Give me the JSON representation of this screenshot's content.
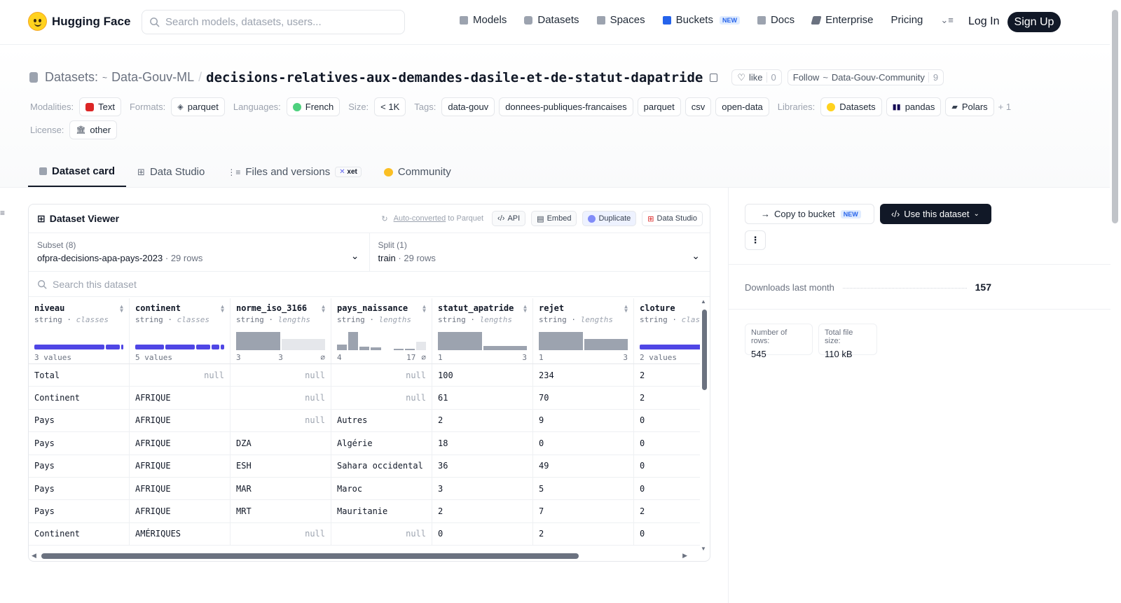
{
  "nav": {
    "brand": "Hugging Face",
    "search_placeholder": "Search models, datasets, users...",
    "links": [
      {
        "label": "Models",
        "icon": "models-icon",
        "color": "#9ca3af"
      },
      {
        "label": "Datasets",
        "icon": "datasets-icon",
        "color": "#9ca3af"
      },
      {
        "label": "Spaces",
        "icon": "spaces-icon",
        "color": "#9ca3af"
      },
      {
        "label": "Buckets",
        "icon": "buckets-icon",
        "color": "#2563eb"
      },
      {
        "label": "Docs",
        "icon": "docs-icon",
        "color": "#9ca3af"
      },
      {
        "label": "Enterprise",
        "icon": "enterprise-icon",
        "color": "#6b7280"
      },
      {
        "label": "Pricing",
        "icon": "",
        "color": ""
      }
    ],
    "buckets_badge": "NEW",
    "login": "Log In",
    "signup": "Sign Up"
  },
  "header": {
    "section": "Datasets:",
    "org": "Data-Gouv-ML",
    "repo": "decisions-relatives-aux-demandes-dasile-et-de-statut-dapatride",
    "like_label": "like",
    "like_count": "0",
    "follow_label": "Follow",
    "follow_org": "Data-Gouv-Community",
    "follow_count": "9",
    "modalities_label": "Modalities:",
    "modality": "Text",
    "formats_label": "Formats:",
    "format": "parquet",
    "languages_label": "Languages:",
    "language": "French",
    "size_label": "Size:",
    "size": "< 1K",
    "tags_label": "Tags:",
    "tags": [
      "data-gouv",
      "donnees-publiques-francaises",
      "parquet",
      "csv",
      "open-data"
    ],
    "libraries_label": "Libraries:",
    "libraries": [
      "Datasets",
      "pandas",
      "Polars"
    ],
    "libraries_more": "+ 1",
    "license_label": "License:",
    "license": "other"
  },
  "tabs": [
    {
      "label": "Dataset card",
      "icon": "cube-icon"
    },
    {
      "label": "Data Studio",
      "icon": "table-icon"
    },
    {
      "label": "Files and versions",
      "icon": "files-icon"
    },
    {
      "label": "Community",
      "icon": "community-icon"
    }
  ],
  "xet_badge": "xet",
  "viewer": {
    "title": "Dataset Viewer",
    "auto_converted": "Auto-converted",
    "to_parquet": "to Parquet",
    "api": "API",
    "embed": "Embed",
    "duplicate": "Duplicate",
    "data_studio": "Data Studio",
    "subset_label": "Subset (8)",
    "subset_value": "ofpra-decisions-apa-pays-2023",
    "subset_rows": "29 rows",
    "split_label": "Split (1)",
    "split_value": "train",
    "split_rows": "29 rows",
    "search_placeholder": "Search this dataset",
    "columns": [
      {
        "name": "niveau",
        "type": "string",
        "kind": "classes",
        "foot_left": "3 values",
        "foot_right": ""
      },
      {
        "name": "continent",
        "type": "string",
        "kind": "classes",
        "foot_left": "5 values",
        "foot_right": ""
      },
      {
        "name": "norme_iso_3166",
        "type": "string",
        "kind": "lengths",
        "foot_left": "3",
        "foot_mid": "3",
        "foot_right": "⌀"
      },
      {
        "name": "pays_naissance",
        "type": "string",
        "kind": "lengths",
        "foot_left": "4",
        "foot_mid": "17",
        "foot_right": "⌀"
      },
      {
        "name": "statut_apatride",
        "type": "string",
        "kind": "lengths",
        "foot_left": "1",
        "foot_right": "3"
      },
      {
        "name": "rejet",
        "type": "string",
        "kind": "lengths",
        "foot_left": "1",
        "foot_right": "3"
      },
      {
        "name": "cloture",
        "type": "string",
        "kind": "classes",
        "foot_left": "2 values",
        "foot_right": ""
      }
    ],
    "rows": [
      [
        "Total",
        null,
        null,
        null,
        "100",
        "234",
        "2"
      ],
      [
        "Continent",
        "AFRIQUE",
        null,
        null,
        "61",
        "70",
        "2"
      ],
      [
        "Pays",
        "AFRIQUE",
        null,
        "Autres",
        "2",
        "9",
        "0"
      ],
      [
        "Pays",
        "AFRIQUE",
        "DZA",
        "Algérie",
        "18",
        "0",
        "0"
      ],
      [
        "Pays",
        "AFRIQUE",
        "ESH",
        "Sahara occidental",
        "36",
        "49",
        "0"
      ],
      [
        "Pays",
        "AFRIQUE",
        "MAR",
        "Maroc",
        "3",
        "5",
        "0"
      ],
      [
        "Pays",
        "AFRIQUE",
        "MRT",
        "Mauritanie",
        "2",
        "7",
        "2"
      ],
      [
        "Continent",
        "AMÉRIQUES",
        null,
        null,
        "0",
        "2",
        "0"
      ]
    ],
    "null_text": "null"
  },
  "sidebar": {
    "copy_bucket": "Copy to bucket",
    "copy_badge": "NEW",
    "use_dataset": "Use this dataset",
    "downloads_label": "Downloads last month",
    "downloads_value": "157",
    "rows_label": "Number of rows:",
    "rows_value": "545",
    "size_label": "Total file size:",
    "size_value": "110 kB"
  }
}
